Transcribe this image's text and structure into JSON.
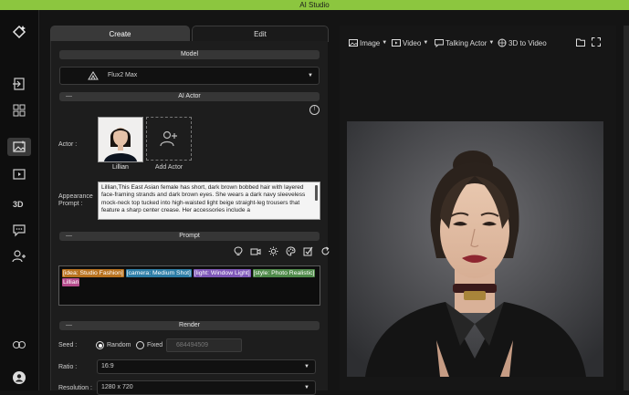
{
  "app_title": "AI Studio",
  "tabs": {
    "create": "Create",
    "edit": "Edit"
  },
  "model": {
    "section": "Model",
    "selected": "Flux2 Max"
  },
  "ai_actor": {
    "section": "AI Actor",
    "actor_label": "Actor :",
    "actor_name": "Lillian",
    "add_actor": "Add Actor",
    "appearance_label_1": "Appearance",
    "appearance_label_2": "Prompt :",
    "appearance_text": "Lillian,This East Asian female has short, dark brown bobbed hair with layered face-framing strands and dark brown eyes. She wears a dark navy sleeveless mock-neck top tucked into high-waisted light beige straight-leg trousers that feature a sharp center crease. Her accessories include a"
  },
  "prompt": {
    "section": "Prompt",
    "tokens": [
      {
        "text": "[idea: Studio Fashion]",
        "color": "#b8721f"
      },
      {
        "text": "[camera: Medium Shot]",
        "color": "#2d7da6"
      },
      {
        "text": "[light: Window Light]",
        "color": "#7f58b8"
      },
      {
        "text": "[style: Photo Realistic]",
        "color": "#4f8a4a"
      },
      {
        "text": "Lillian",
        "color": "#b64c8c"
      }
    ]
  },
  "render": {
    "section": "Render",
    "seed_label": "Seed :",
    "seed_random": "Random",
    "seed_fixed": "Fixed",
    "seed_value": "684494509",
    "ratio_label": "Ratio :",
    "ratio_value": "16:9",
    "resolution_label": "Resolution :",
    "resolution_value": "1280 x 720"
  },
  "right_toolbar": {
    "image": "Image",
    "video": "Video",
    "talking_actor": "Talking Actor",
    "to_video": "3D to Video"
  },
  "colors": {
    "accent": "#8cc63f",
    "panel": "#1d1d1d",
    "background": "#141414"
  }
}
